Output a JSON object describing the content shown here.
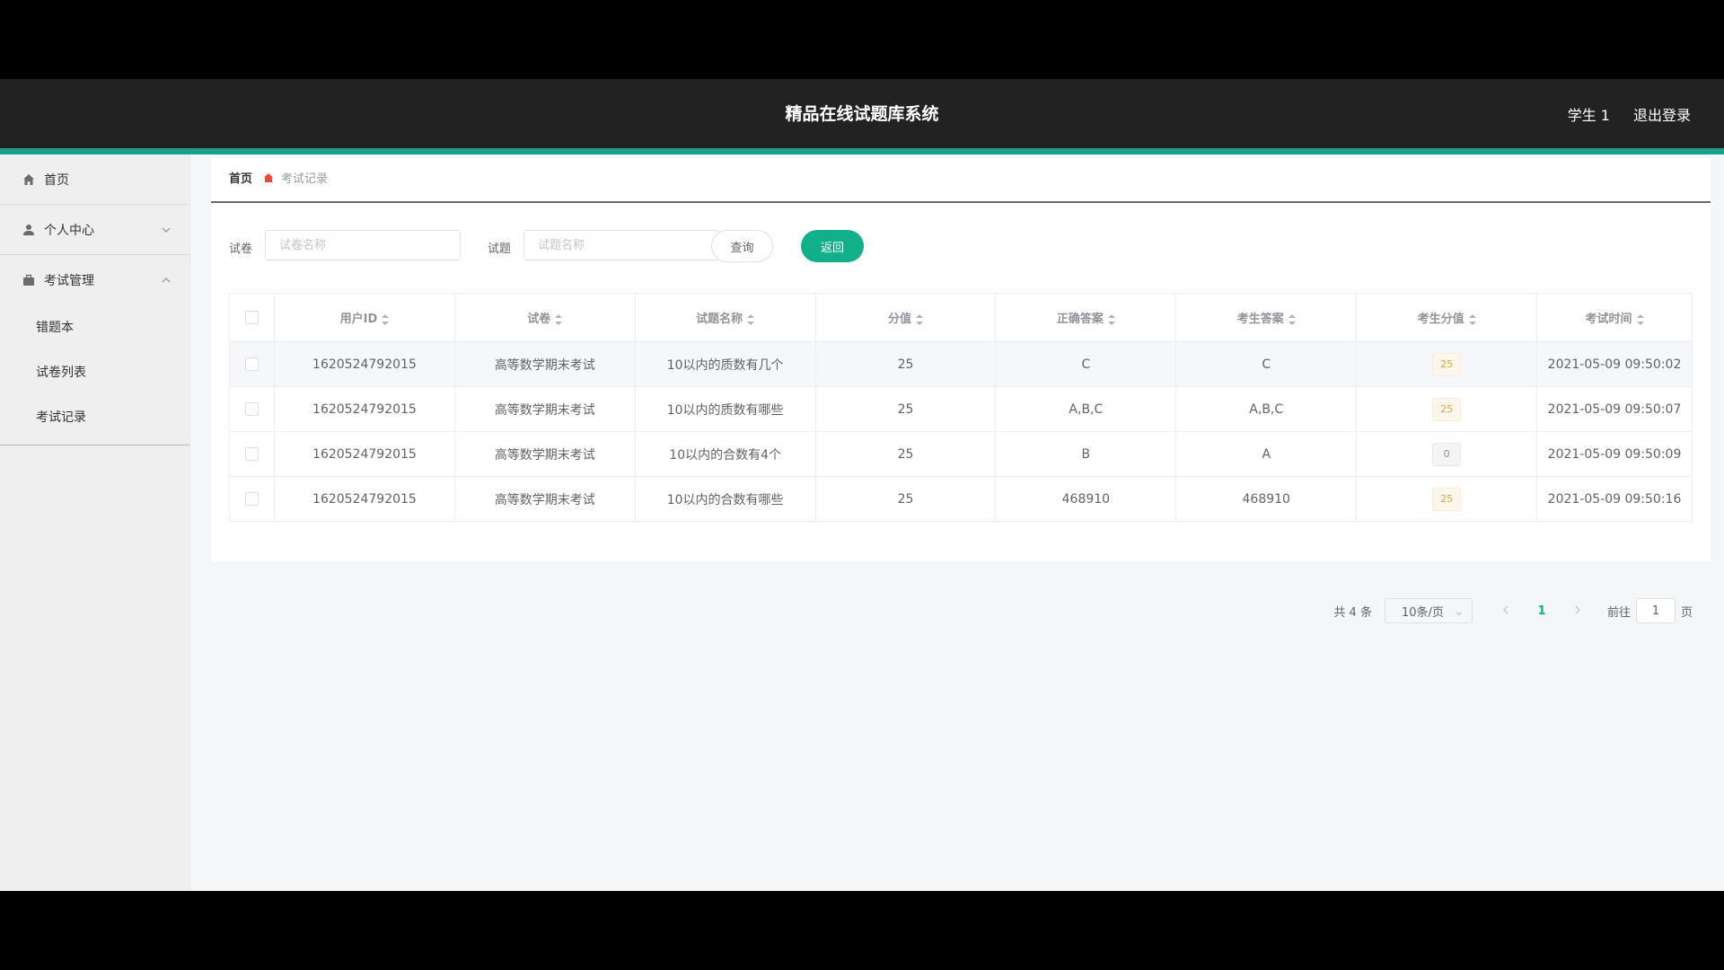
{
  "header": {
    "title": "精品在线试题库系统",
    "user": "学生 1",
    "logout": "退出登录"
  },
  "sidebar": {
    "home": "首页",
    "personal": "个人中心",
    "exam_mgmt": "考试管理",
    "sub_items": [
      "错题本",
      "试卷列表",
      "考试记录"
    ]
  },
  "breadcrumb": {
    "home": "首页",
    "current": "考试记录"
  },
  "search": {
    "paper_label": "试卷",
    "paper_placeholder": "试卷名称",
    "question_label": "试题",
    "question_placeholder": "试题名称",
    "query_button": "查询",
    "back_button": "返回"
  },
  "table": {
    "headers": [
      "用户ID",
      "试卷",
      "试题名称",
      "分值",
      "正确答案",
      "考生答案",
      "考生分值",
      "考试时间"
    ],
    "rows": [
      {
        "user_id": "1620524792015",
        "paper": "高等数学期末考试",
        "question": "10以内的质数有几个",
        "score": "25",
        "correct": "C",
        "answer": "C",
        "student_score": "25",
        "time": "2021-05-09 09:50:02"
      },
      {
        "user_id": "1620524792015",
        "paper": "高等数学期末考试",
        "question": "10以内的质数有哪些",
        "score": "25",
        "correct": "A,B,C",
        "answer": "A,B,C",
        "student_score": "25",
        "time": "2021-05-09 09:50:07"
      },
      {
        "user_id": "1620524792015",
        "paper": "高等数学期末考试",
        "question": "10以内的合数有4个",
        "score": "25",
        "correct": "B",
        "answer": "A",
        "student_score": "0",
        "time": "2021-05-09 09:50:09"
      },
      {
        "user_id": "1620524792015",
        "paper": "高等数学期末考试",
        "question": "10以内的合数有哪些",
        "score": "25",
        "correct": "468910",
        "answer": "468910",
        "student_score": "25",
        "time": "2021-05-09 09:50:16"
      }
    ]
  },
  "pagination": {
    "total": "共 4 条",
    "page_size": "10条/页",
    "current_page": "1",
    "goto_prefix": "前往",
    "goto_value": "1",
    "goto_suffix": "页"
  },
  "colors": {
    "accent": "#12b08a",
    "topbar": "#222222",
    "accent_bar": "#16a08d"
  }
}
